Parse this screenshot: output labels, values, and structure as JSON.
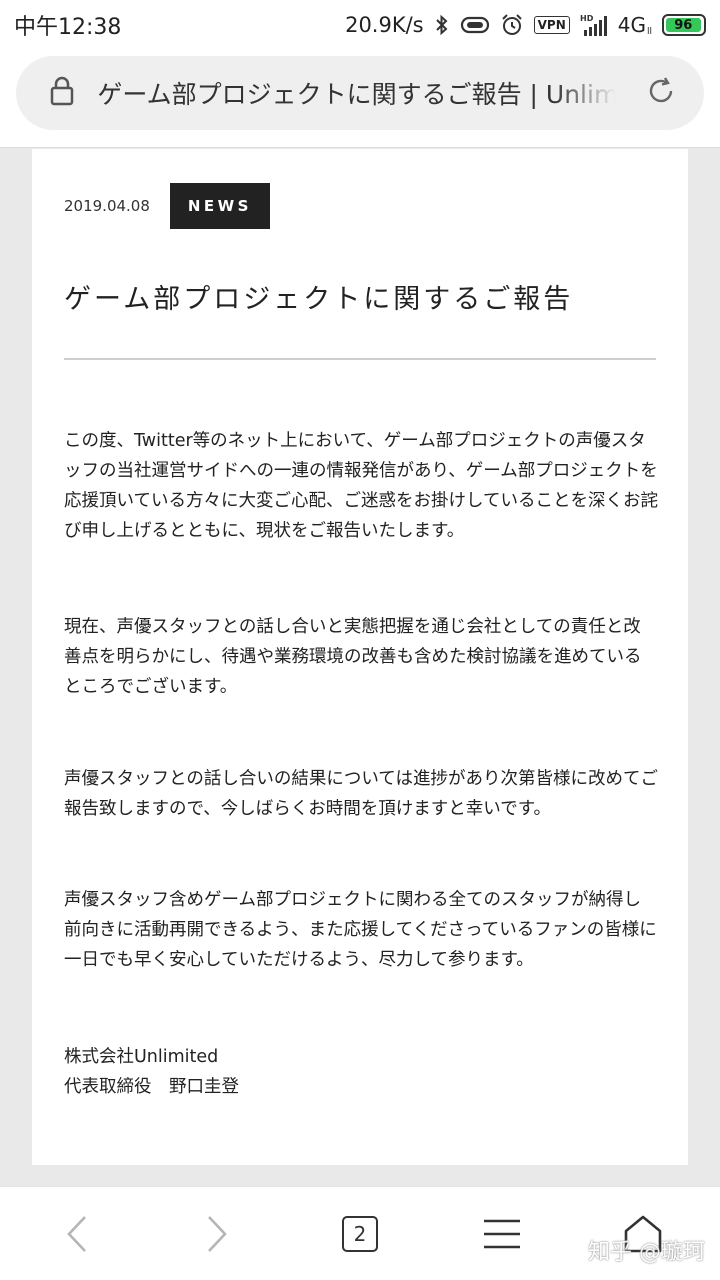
{
  "status_bar": {
    "time": "中午12:38",
    "speed": "20.9K/s",
    "vpn": "VPN",
    "hd": "HD",
    "network": "4G",
    "network_sub": "ll",
    "battery": "96",
    "battery_level": 0.96,
    "battery_color": "#35c759"
  },
  "browser": {
    "url_text": "ゲーム部プロジェクトに関するご報告 | Unlimited",
    "tab_count": "2"
  },
  "article": {
    "date": "2019.04.08",
    "badge": "NEWS",
    "title": "ゲーム部プロジェクトに関するご報告",
    "paragraphs": [
      "この度、Twitter等のネット上において、ゲーム部プロジェクトの声優スタッフの当社運営サイドへの一連の情報発信があり、ゲーム部プロジェクトを応援頂いている方々に大変ご心配、ご迷惑をお掛けしていることを深くお詫び申し上げるとともに、現状をご報告いたします。",
      "現在、声優スタッフとの話し合いと実態把握を通じ会社としての責任と改善点を明らかにし、待遇や業務環境の改善も含めた検討協議を進めているところでございます。",
      "声優スタッフとの話し合いの結果については進捗があり次第皆様に改めてご報告致しますので、今しばらくお時間を頂けますと幸いです。",
      "声優スタッフ含めゲーム部プロジェクトに関わる全てのスタッフが納得し前向きに活動再開できるよう、また応援してくださっているファンの皆様に一日でも早く安心していただけるよう、尽力して参ります。"
    ],
    "company": "株式会社Unlimited",
    "representative": "代表取締役　野口圭登"
  },
  "watermark": "知乎 @璇珂",
  "icons": {
    "bluetooth": "bluetooth-icon",
    "vibrate": "vibrate-icon",
    "alarm": "alarm-icon",
    "signal": "signal-icon",
    "lock": "lock-icon",
    "reload": "reload-icon",
    "back": "back-arrow-icon",
    "forward": "forward-arrow-icon",
    "menu": "menu-icon",
    "home": "home-icon"
  }
}
